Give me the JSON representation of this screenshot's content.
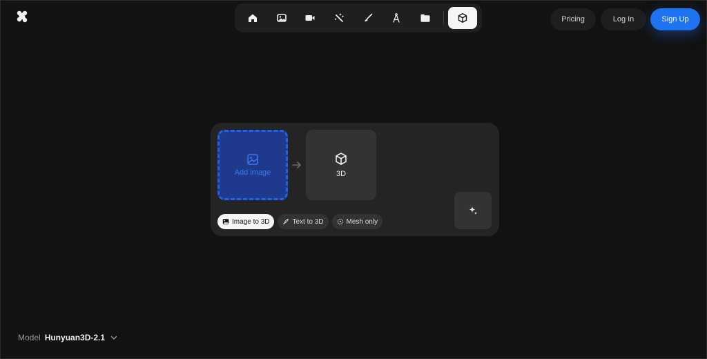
{
  "header": {
    "logo": "app-logo-icon",
    "toolbar": {
      "tools": [
        {
          "icon": "home-icon"
        },
        {
          "icon": "image-icon"
        },
        {
          "icon": "video-icon"
        },
        {
          "icon": "magic-wand-icon"
        },
        {
          "icon": "brush-icon"
        },
        {
          "icon": "compass-icon"
        },
        {
          "icon": "folder-icon"
        },
        {
          "icon": "cube-icon",
          "active": true
        }
      ]
    },
    "nav": {
      "pricing": "Pricing",
      "login": "Log In",
      "signup": "Sign Up"
    }
  },
  "panel": {
    "input_tile": {
      "label": "Add image",
      "icon": "image-add-icon"
    },
    "output_tile": {
      "label": "3D",
      "icon": "cube-icon"
    },
    "generate_icon": "sparkle-icon",
    "modes": [
      {
        "label": "Image to 3D",
        "icon": "image-icon",
        "active": true
      },
      {
        "label": "Text to 3D",
        "icon": "pen-icon",
        "active": false
      },
      {
        "label": "Mesh only",
        "icon": "mesh-icon",
        "active": false
      }
    ]
  },
  "model": {
    "label": "Model",
    "name": "Hunyuan3D-2.1"
  },
  "colors": {
    "background": "#121212",
    "accent": "#1d73f0",
    "panel": "#242424"
  }
}
